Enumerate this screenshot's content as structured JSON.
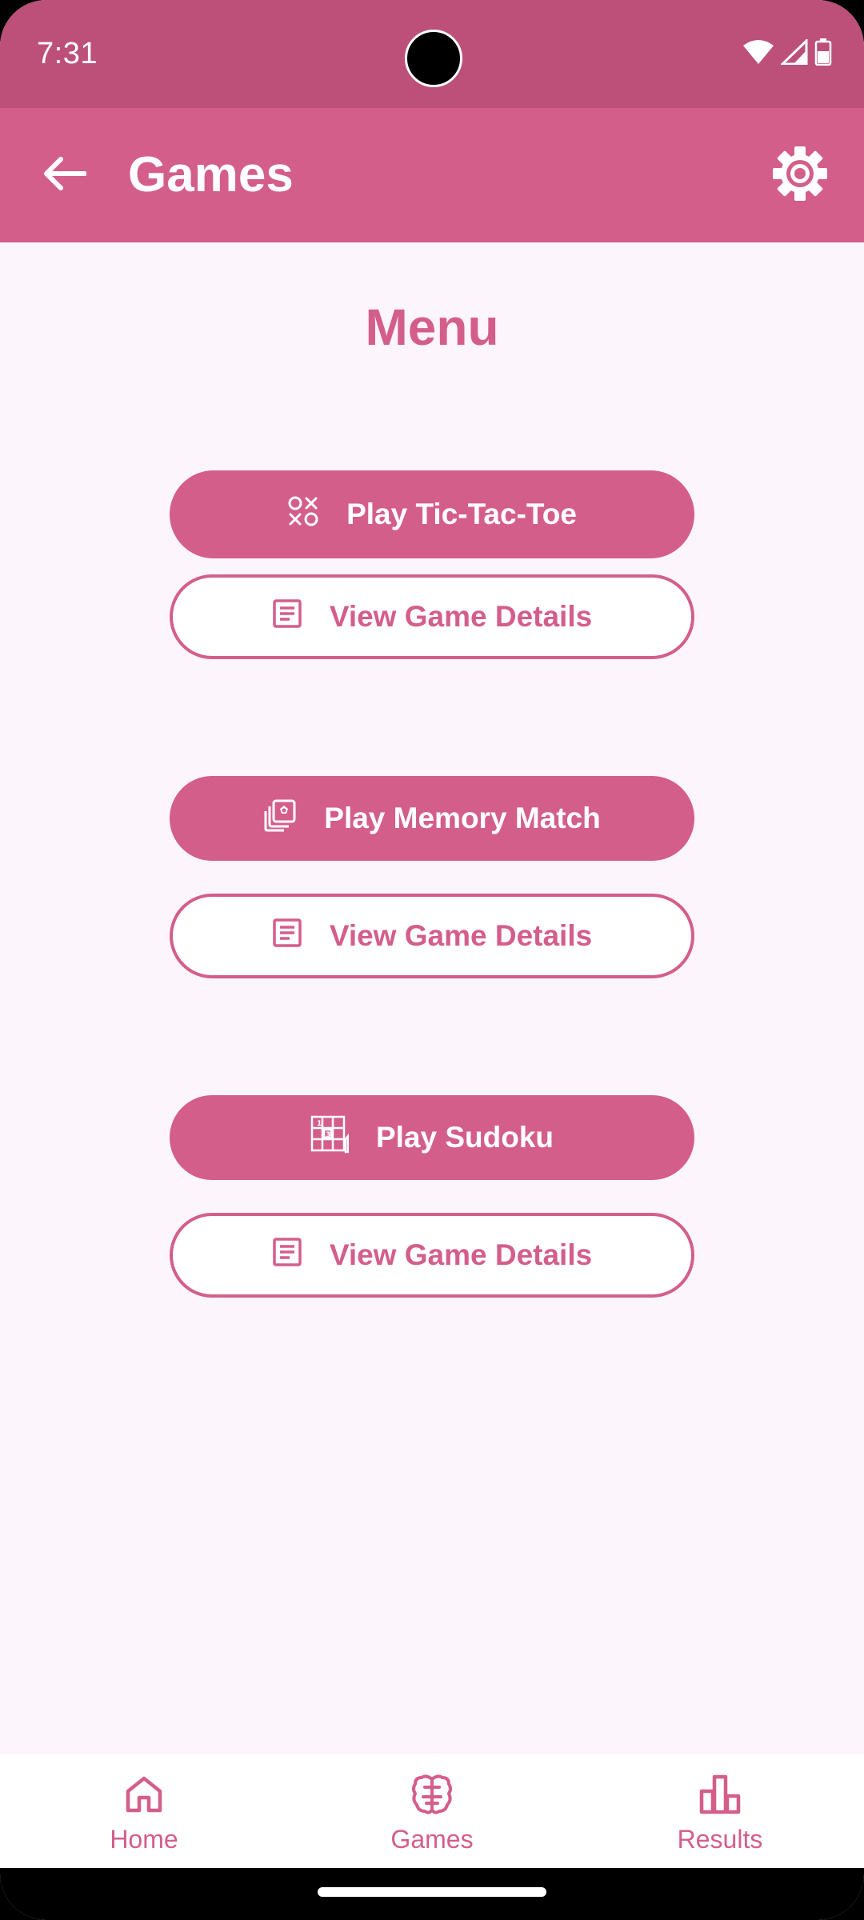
{
  "status_bar": {
    "time": "7:31"
  },
  "app_bar": {
    "title": "Games"
  },
  "main": {
    "heading": "Menu",
    "games": [
      {
        "play_label": "Play Tic-Tac-Toe",
        "details_label": "View Game Details",
        "icon": "tic-tac-toe-icon"
      },
      {
        "play_label": "Play Memory Match",
        "details_label": "View Game Details",
        "icon": "memory-cards-icon"
      },
      {
        "play_label": "Play Sudoku",
        "details_label": "View Game Details",
        "icon": "sudoku-grid-icon"
      }
    ]
  },
  "bottom_nav": {
    "items": [
      {
        "label": "Home",
        "icon": "home-icon"
      },
      {
        "label": "Games",
        "icon": "brain-icon",
        "selected": true
      },
      {
        "label": "Results",
        "icon": "bar-chart-icon"
      }
    ]
  },
  "colors": {
    "status_bar": "#BC5078",
    "app_bar": "#D45E8A",
    "accent": "#D45E8A",
    "background": "#FDF5FC"
  }
}
